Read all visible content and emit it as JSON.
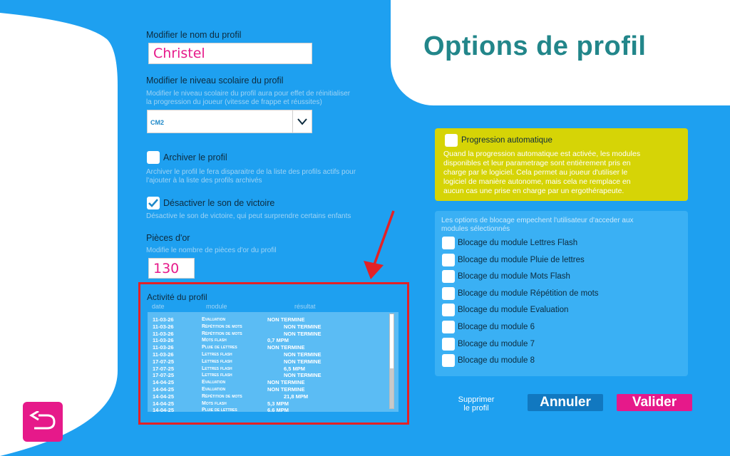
{
  "page": {
    "title": "Options de profil"
  },
  "profile_name": {
    "label": "Modifier le nom du profil",
    "value": "Christel"
  },
  "school_level": {
    "label": "Modifier le niveau scolaire du profil",
    "hint_line1": "Modifier le niveau scolaire du profil aura pour effet de réinitialiser",
    "hint_line2": "la progression du joueur (vitesse de frappe et réussites)",
    "selected": "CM2"
  },
  "archive": {
    "label": "Archiver le profil",
    "checked": false,
    "hint_line1": "Archiver le profil le fera disparaitre de la liste des profils actifs pour",
    "hint_line2": "l'ajouter à la liste des profils archivés"
  },
  "victory_sound": {
    "label": "Désactiver le son de victoire",
    "checked": true,
    "hint": "Désactive le son de victoire, qui peut surprendre certains enfants"
  },
  "gold": {
    "label": "Pièces d'or",
    "hint": "Modifie le nombre de pièces d'or du profil",
    "value": "130"
  },
  "activity": {
    "title": "Activité du profil",
    "col_date": "date",
    "col_module": "module",
    "col_result": "résultat",
    "rows": [
      {
        "date": "11-03-26",
        "module": "Evaluation",
        "result": "NON TERMINE",
        "indent": false
      },
      {
        "date": "11-03-26",
        "module": "Répétition de mots",
        "result": "NON TERMINE",
        "indent": true
      },
      {
        "date": "11-03-26",
        "module": "Répétition de mots",
        "result": "NON TERMINE",
        "indent": true
      },
      {
        "date": "11-03-26",
        "module": "Mots flash",
        "result": "0,7 MPM",
        "indent": false
      },
      {
        "date": "11-03-26",
        "module": "Pluie de lettres",
        "result": "NON TERMINE",
        "indent": false
      },
      {
        "date": "11-03-26",
        "module": "Lettres flash",
        "result": "NON TERMINE",
        "indent": true
      },
      {
        "date": "17-07-25",
        "module": "Lettres flash",
        "result": "NON TERMINE",
        "indent": true
      },
      {
        "date": "17-07-25",
        "module": "Lettres flash",
        "result": "6,5 MPM",
        "indent": true
      },
      {
        "date": "17-07-25",
        "module": "Lettres flash",
        "result": "NON TERMINE",
        "indent": true
      },
      {
        "date": "14-04-25",
        "module": "Evaluation",
        "result": "NON TERMINE",
        "indent": false
      },
      {
        "date": "14-04-25",
        "module": "Evaluation",
        "result": "NON TERMINE",
        "indent": false
      },
      {
        "date": "14-04-25",
        "module": "Répétition de mots",
        "result": "21,8 MPM",
        "indent": true
      },
      {
        "date": "14-04-25",
        "module": "Mots flash",
        "result": "5,3 MPM",
        "indent": false
      },
      {
        "date": "14-04-25",
        "module": "Pluie de lettres",
        "result": "6,6 MPM",
        "indent": false
      }
    ]
  },
  "auto_progression": {
    "label": "Progression automatique",
    "checked": false,
    "desc_lines": [
      "Quand la progression automatique est activée, les modules",
      "disponibles et leur parametrage sont entièrement pris en",
      "charge par le logiciel. Cela permet au joueur d'utiliser le",
      "logiciel de manière autonome, mais cela ne remplace en",
      "aucun cas une prise en charge par un ergothérapeute."
    ]
  },
  "blocking": {
    "hint_line1": "Les options de blocage empechent l'utilisateur d'acceder aux",
    "hint_line2": "modules sélectionnés",
    "items": [
      "Blocage du module Lettres Flash",
      "Blocage du module Pluie de lettres",
      "Blocage du module Mots Flash",
      "Blocage du module Répétition de mots",
      "Blocage du module Evaluation",
      "Blocage du module 6",
      "Blocage du module 7",
      "Blocage du module 8"
    ]
  },
  "actions": {
    "delete_line1": "Supprimer",
    "delete_line2": "le profil",
    "cancel": "Annuler",
    "validate": "Valider"
  },
  "colors": {
    "background": "#1ea0f0",
    "accent": "#e6198a",
    "title": "#22868a",
    "highlight": "#d6d406",
    "annotation": "#e32126"
  }
}
